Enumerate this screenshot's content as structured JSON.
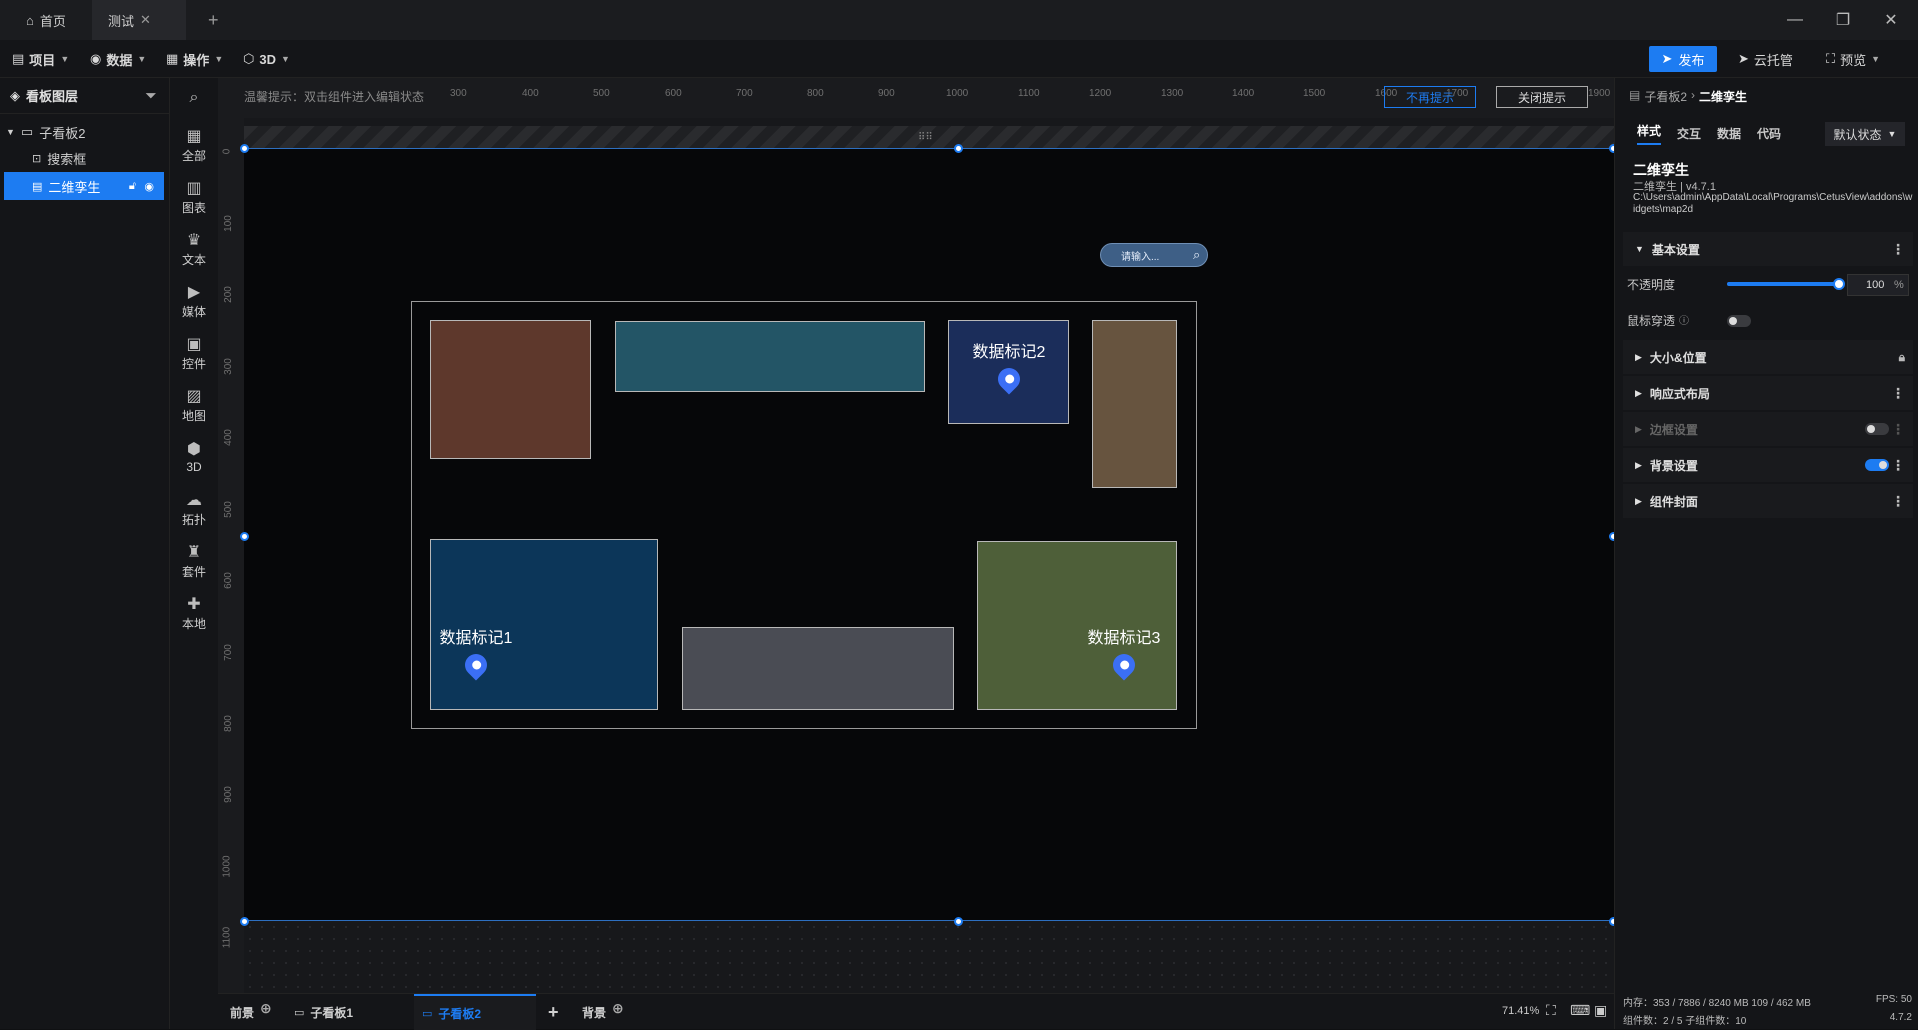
{
  "tabs": [
    {
      "label": "首页"
    },
    {
      "label": "测试"
    }
  ],
  "toolbar": {
    "menus": [
      "项目",
      "数据",
      "操作",
      "3D"
    ],
    "publish": "发布",
    "cloud": "云托管",
    "preview": "预览"
  },
  "layers": {
    "title": "看板图层",
    "items": [
      "子看板2",
      "搜索框",
      "二维孪生"
    ]
  },
  "components": [
    "全部",
    "图表",
    "文本",
    "媒体",
    "控件",
    "地图",
    "3D",
    "拓扑",
    "套件",
    "本地"
  ],
  "canvas": {
    "hint": "温馨提示：双击组件进入编辑状态",
    "no_more_hint": "不再提示",
    "close_hint": "关闭提示",
    "ruler_x": [
      "300",
      "400",
      "500",
      "600",
      "700",
      "800",
      "900",
      "1000",
      "1100",
      "1200",
      "1300",
      "1400",
      "1500",
      "1600",
      "1700",
      "1900"
    ],
    "ruler_y": [
      "0",
      "100",
      "200",
      "300",
      "400",
      "500",
      "600",
      "700",
      "800",
      "900",
      "1000",
      "1100"
    ],
    "search_placeholder": "请输入...",
    "markers": [
      "数据标记1",
      "数据标记2",
      "数据标记3"
    ],
    "colors": {
      "brown": "#5e382c",
      "teal": "#235566",
      "navy": "#1b2d5a",
      "khaki": "#67543f",
      "blue": "#0c3659",
      "gray": "#4a4c54",
      "olive": "#4e5f39"
    }
  },
  "bottom": {
    "tabs": [
      "前景",
      "子看板1",
      "子看板2",
      "背景"
    ],
    "zoom": "71.41%"
  },
  "props": {
    "breadcrumb_parent": "子看板2",
    "breadcrumb_current": "二维孪生",
    "tabs": [
      "样式",
      "交互",
      "数据",
      "代码"
    ],
    "state": "默认状态",
    "name": "二维孪生",
    "version": "二维孪生 | v4.7.1",
    "path": "C:\\Users\\admin\\AppData\\Local\\Programs\\CetusView\\addons\\widgets\\map2d",
    "basic": "基本设置",
    "opacity_label": "不透明度",
    "opacity_value": "100",
    "opacity_unit": "%",
    "opacity_fraction": 1.0,
    "mouse_through": "鼠标穿透",
    "size_pos": "大小&位置",
    "responsive": "响应式布局",
    "border": "边框设置",
    "background": "背景设置",
    "cover": "组件封面",
    "memory": "内存：353 / 7886 / 8240 MB  109 / 462 MB",
    "fps": "FPS:  50",
    "counts": "组件数：2 / 5    子组件数：10",
    "build": "4.7.2"
  }
}
